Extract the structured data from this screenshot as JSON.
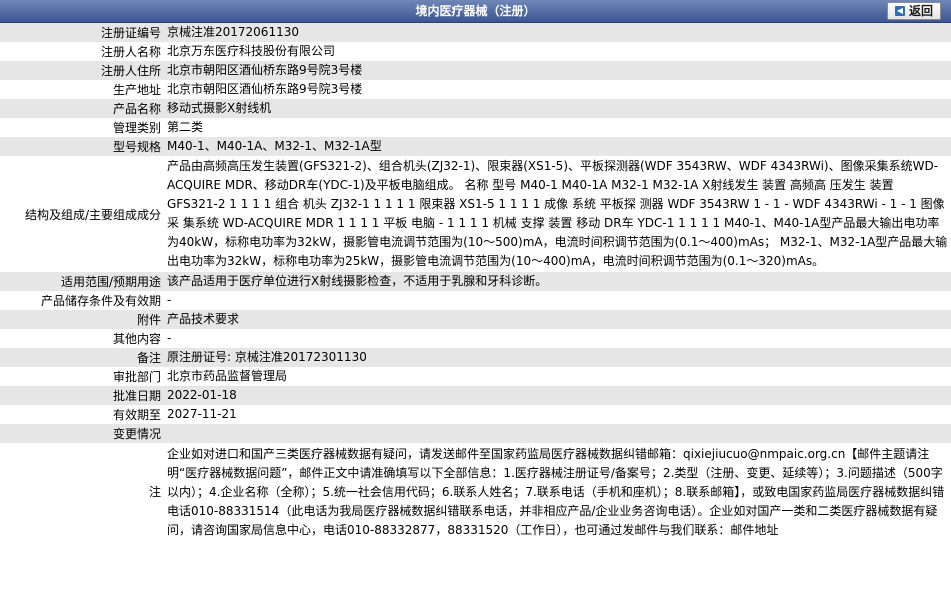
{
  "header": {
    "title": "境内医疗器械（注册）",
    "back_label": "返回"
  },
  "rows": [
    {
      "label": "注册证编号",
      "value": "京械注准20172061130"
    },
    {
      "label": "注册人名称",
      "value": "北京万东医疗科技股份有限公司"
    },
    {
      "label": "注册人住所",
      "value": "北京市朝阳区酒仙桥东路9号院3号楼"
    },
    {
      "label": "生产地址",
      "value": "北京市朝阳区酒仙桥东路9号院3号楼"
    },
    {
      "label": "产品名称",
      "value": "移动式摄影X射线机"
    },
    {
      "label": "管理类别",
      "value": "第二类"
    },
    {
      "label": "型号规格",
      "value": "M40-1、M40-1A、M32-1、M32-1A型"
    },
    {
      "label": "结构及组成/主要组成成分",
      "value": "产品由高频高压发生装置(GFS321-2)、组合机头(ZJ32-1)、限束器(XS1-5)、平板探测器(WDF 3543RW、WDF 4343RWi)、图像采集系统WD-ACQUIRE MDR、移动DR车(YDC-1)及平板电脑组成。 名称 型号 M40-1 M40-1A M32-1 M32-1A X射线发生 装置 高频高 压发生 装置 GFS321-2 1 1 1 1 组合 机头 ZJ32-1 1 1 1 1 限束器 XS1-5 1 1 1 1 成像 系统 平板探 测器 WDF 3543RW 1 - 1 - WDF 4343RWi - 1 - 1 图像采 集系统 WD-ACQUIRE MDR 1 1 1 1 平板 电脑 - 1 1 1 1 机械 支撑 装置 移动 DR车 YDC-1 1 1 1 1 M40-1、M40-1A型产品最大输出电功率为40kW，标称电功率为32kW，摄影管电流调节范围为(10～500)mA，电流时间积调节范围为(0.1～400)mAs； M32-1、M32-1A型产品最大输出电功率为32kW，标称电功率为25kW，摄影管电流调节范围为(10～400)mA，电流时间积调节范围为(0.1～320)mAs。"
    },
    {
      "label": "适用范围/预期用途",
      "value": "该产品适用于医疗单位进行X射线摄影检查，不适用于乳腺和牙科诊断。"
    },
    {
      "label": "产品储存条件及有效期",
      "value": "-"
    },
    {
      "label": "附件",
      "value": "产品技术要求"
    },
    {
      "label": "其他内容",
      "value": "-"
    },
    {
      "label": "备注",
      "value": "原注册证号: 京械注准20172301130"
    },
    {
      "label": "审批部门",
      "value": "北京市药品监督管理局"
    },
    {
      "label": "批准日期",
      "value": "2022-01-18"
    },
    {
      "label": "有效期至",
      "value": "2027-11-21"
    },
    {
      "label": "变更情况",
      "value": ""
    },
    {
      "label": "注",
      "value": "企业如对进口和国产三类医疗器械数据有疑问，请发送邮件至国家药监局医疗器械数据纠错邮箱：qixiejiucuo@nmpaic.org.cn【邮件主题请注明“医疗器械数据问题”，邮件正文中请准确填写以下全部信息：1.医疗器械注册证号/备案号；2.类型（注册、变更、延续等）；3.问题描述（500字以内）；4.企业名称（全称）；5.统一社会信用代码；6.联系人姓名；7.联系电话（手机和座机）；8.联系邮箱】，或致电国家药监局医疗器械数据纠错电话010-88331514（此电话为我局医疗器械数据纠错联系电话，并非相应产品/企业业务咨询电话）。企业如对国产一类和二类医疗器械数据有疑问，请咨询国家局信息中心，电话010-88332877，88331520（工作日），也可通过发邮件与我们联系：邮件地址"
    }
  ]
}
